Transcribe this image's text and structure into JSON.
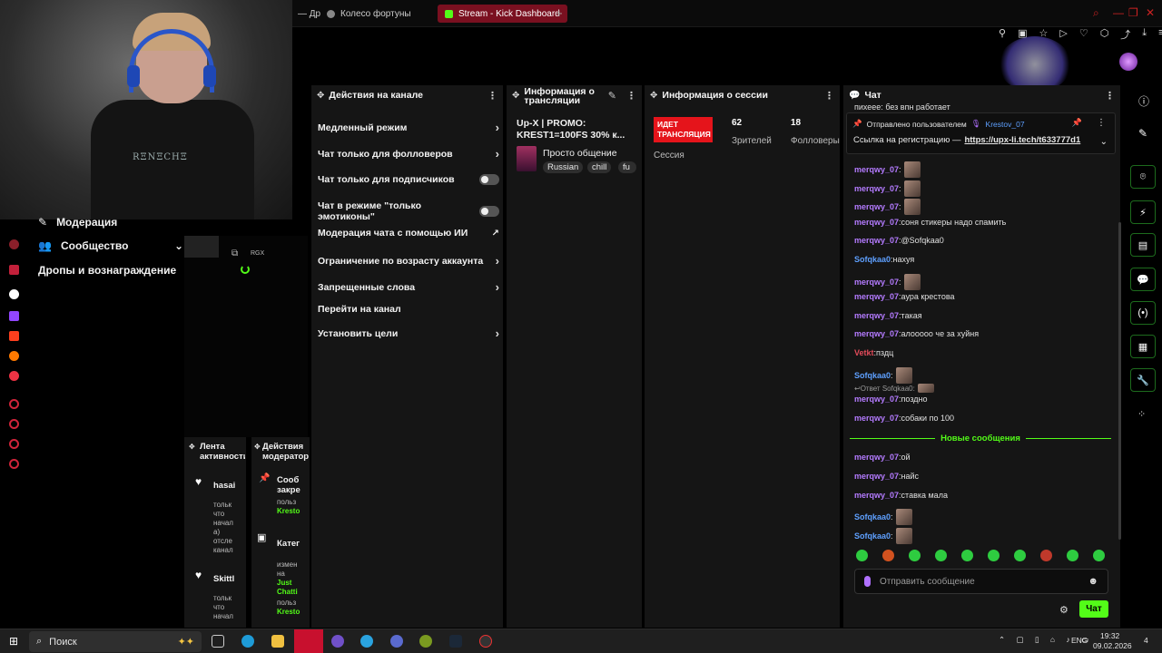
{
  "browser": {
    "tabs": [
      {
        "label": "— Др"
      },
      {
        "label": "Колесо фортуны"
      },
      {
        "label": "Stream - Kick Dashboard"
      }
    ],
    "new_tab": "+"
  },
  "webcam": {
    "shirt_print": "RΞNΞCHΞ"
  },
  "left_menu": {
    "moderation": "Модерация",
    "community": "Сообщество",
    "drops": "Дропы и вознаграждение"
  },
  "thumb": {
    "label": "RGX"
  },
  "channel_actions": {
    "title": "Действия на канале",
    "items": [
      {
        "label": "Медленный режим",
        "control": "chevron"
      },
      {
        "label": "Чат только для фолловеров",
        "control": "chevron"
      },
      {
        "label": "Чат только для подписчиков",
        "control": "toggle"
      },
      {
        "label": "Чат в режиме \"только эмотиконы\"",
        "control": "toggle"
      },
      {
        "label": "Модерация чата с помощью ИИ",
        "control": "external"
      },
      {
        "label": "Ограничение по возрасту аккаунта",
        "control": "chevron"
      },
      {
        "label": "Запрещенные слова",
        "control": "chevron"
      },
      {
        "label": "Перейти на канал",
        "control": "none"
      },
      {
        "label": "Установить цели",
        "control": "chevron"
      }
    ]
  },
  "stream_info": {
    "title": "Информация о трансляции",
    "stream_title": "Up-X | PROMO: KREST1=100FS 30% к...",
    "category": "Просто общение",
    "tags": [
      "Russian",
      "chill",
      "fu"
    ]
  },
  "session": {
    "title": "Информация о сессии",
    "live_badge": "ИДЕТ ТРАНСЛЯЦИЯ",
    "session_label": "Сессия",
    "viewers_value": "62",
    "viewers_label": "Зрителей",
    "followers_value": "18",
    "followers_label": "Фолловеры"
  },
  "chat": {
    "title": "Чат",
    "top_clip": "пихеее: без впн работает",
    "pinned": {
      "header": "Отправлено пользователем",
      "author": "Krestov_07",
      "text": "Ссылка на регистрацию —",
      "link": "https://upx-li.tech/t633777d1"
    },
    "messages": [
      {
        "user": "merqwy_07",
        "text": "",
        "emote": true,
        "cls": "u1"
      },
      {
        "user": "merqwy_07",
        "text": "",
        "emote": true,
        "cls": "u1"
      },
      {
        "user": "merqwy_07",
        "text": "",
        "emote": true,
        "cls": "u1"
      },
      {
        "user": "merqwy_07",
        "text": "соня стикеры надо спамить",
        "emote": false,
        "cls": "u1"
      },
      {
        "user": "merqwy_07",
        "text": "@Sofqkaa0",
        "emote": false,
        "cls": "u1"
      },
      {
        "user": "Sofqkaa0",
        "text": "нахуя",
        "emote": false,
        "cls": "u2"
      },
      {
        "user": "merqwy_07",
        "text": "",
        "emote": true,
        "cls": "u1"
      },
      {
        "user": "merqwy_07",
        "text": "аура крестова",
        "emote": false,
        "cls": "u1"
      },
      {
        "user": "merqwy_07",
        "text": "такая",
        "emote": false,
        "cls": "u1"
      },
      {
        "user": "merqwy_07",
        "text": "алоoooo че за хуйня",
        "emote": false,
        "cls": "u1"
      },
      {
        "user": "Vetkt",
        "text": "пздц",
        "emote": false,
        "cls": "u3"
      },
      {
        "user": "Sofqkaa0",
        "text": "",
        "emote": true,
        "cls": "u2"
      },
      {
        "user": "merqwy_07",
        "text": "поздно",
        "emote": false,
        "cls": "u1"
      },
      {
        "user": "merqwy_07",
        "text": "собаки по 100",
        "emote": false,
        "cls": "u1"
      }
    ],
    "reply_hint": "Ответ Sofqkaa0:",
    "new_messages": "Новые сообщения",
    "messages_after": [
      {
        "user": "merqwy_07",
        "text": "ой",
        "emote": false,
        "cls": "u1"
      },
      {
        "user": "merqwy_07",
        "text": "найс",
        "emote": false,
        "cls": "u1"
      },
      {
        "user": "merqwy_07",
        "text": "ставка мала",
        "emote": false,
        "cls": "u1"
      },
      {
        "user": "Sofqkaa0",
        "text": "",
        "emote": true,
        "cls": "u2"
      },
      {
        "user": "Sofqkaa0",
        "text": "",
        "emote": true,
        "cls": "u2"
      }
    ],
    "input_placeholder": "Отправить сообщение",
    "send_label": "Чат"
  },
  "activity": {
    "title": "Лента активности",
    "entries": [
      {
        "name": "hasai",
        "lines": [
          "тольк",
          "что",
          "начал",
          "а)",
          "отсле",
          "канал"
        ]
      },
      {
        "name": "Skittl",
        "lines": [
          "тольк",
          "что",
          "начал"
        ]
      }
    ]
  },
  "mod_actions": {
    "title": "Действия модератор",
    "entries": [
      {
        "name": "Сооб закре",
        "lines": [
          "польз"
        ],
        "user": "Kresto"
      },
      {
        "name": "Катег",
        "lines": [
          "измен",
          "на"
        ],
        "user": "Just Chatti",
        "tail": "польз",
        "user2": "Kresto"
      }
    ]
  },
  "taskbar": {
    "search": "Поиск",
    "lang": "ENG",
    "time": "19:32",
    "date": "09.02.2026",
    "notif": "4"
  },
  "colors": {
    "accent": "#53fc18",
    "live": "#e5141b",
    "user_purple": "#b47bff",
    "user_blue": "#5ea0ff"
  }
}
